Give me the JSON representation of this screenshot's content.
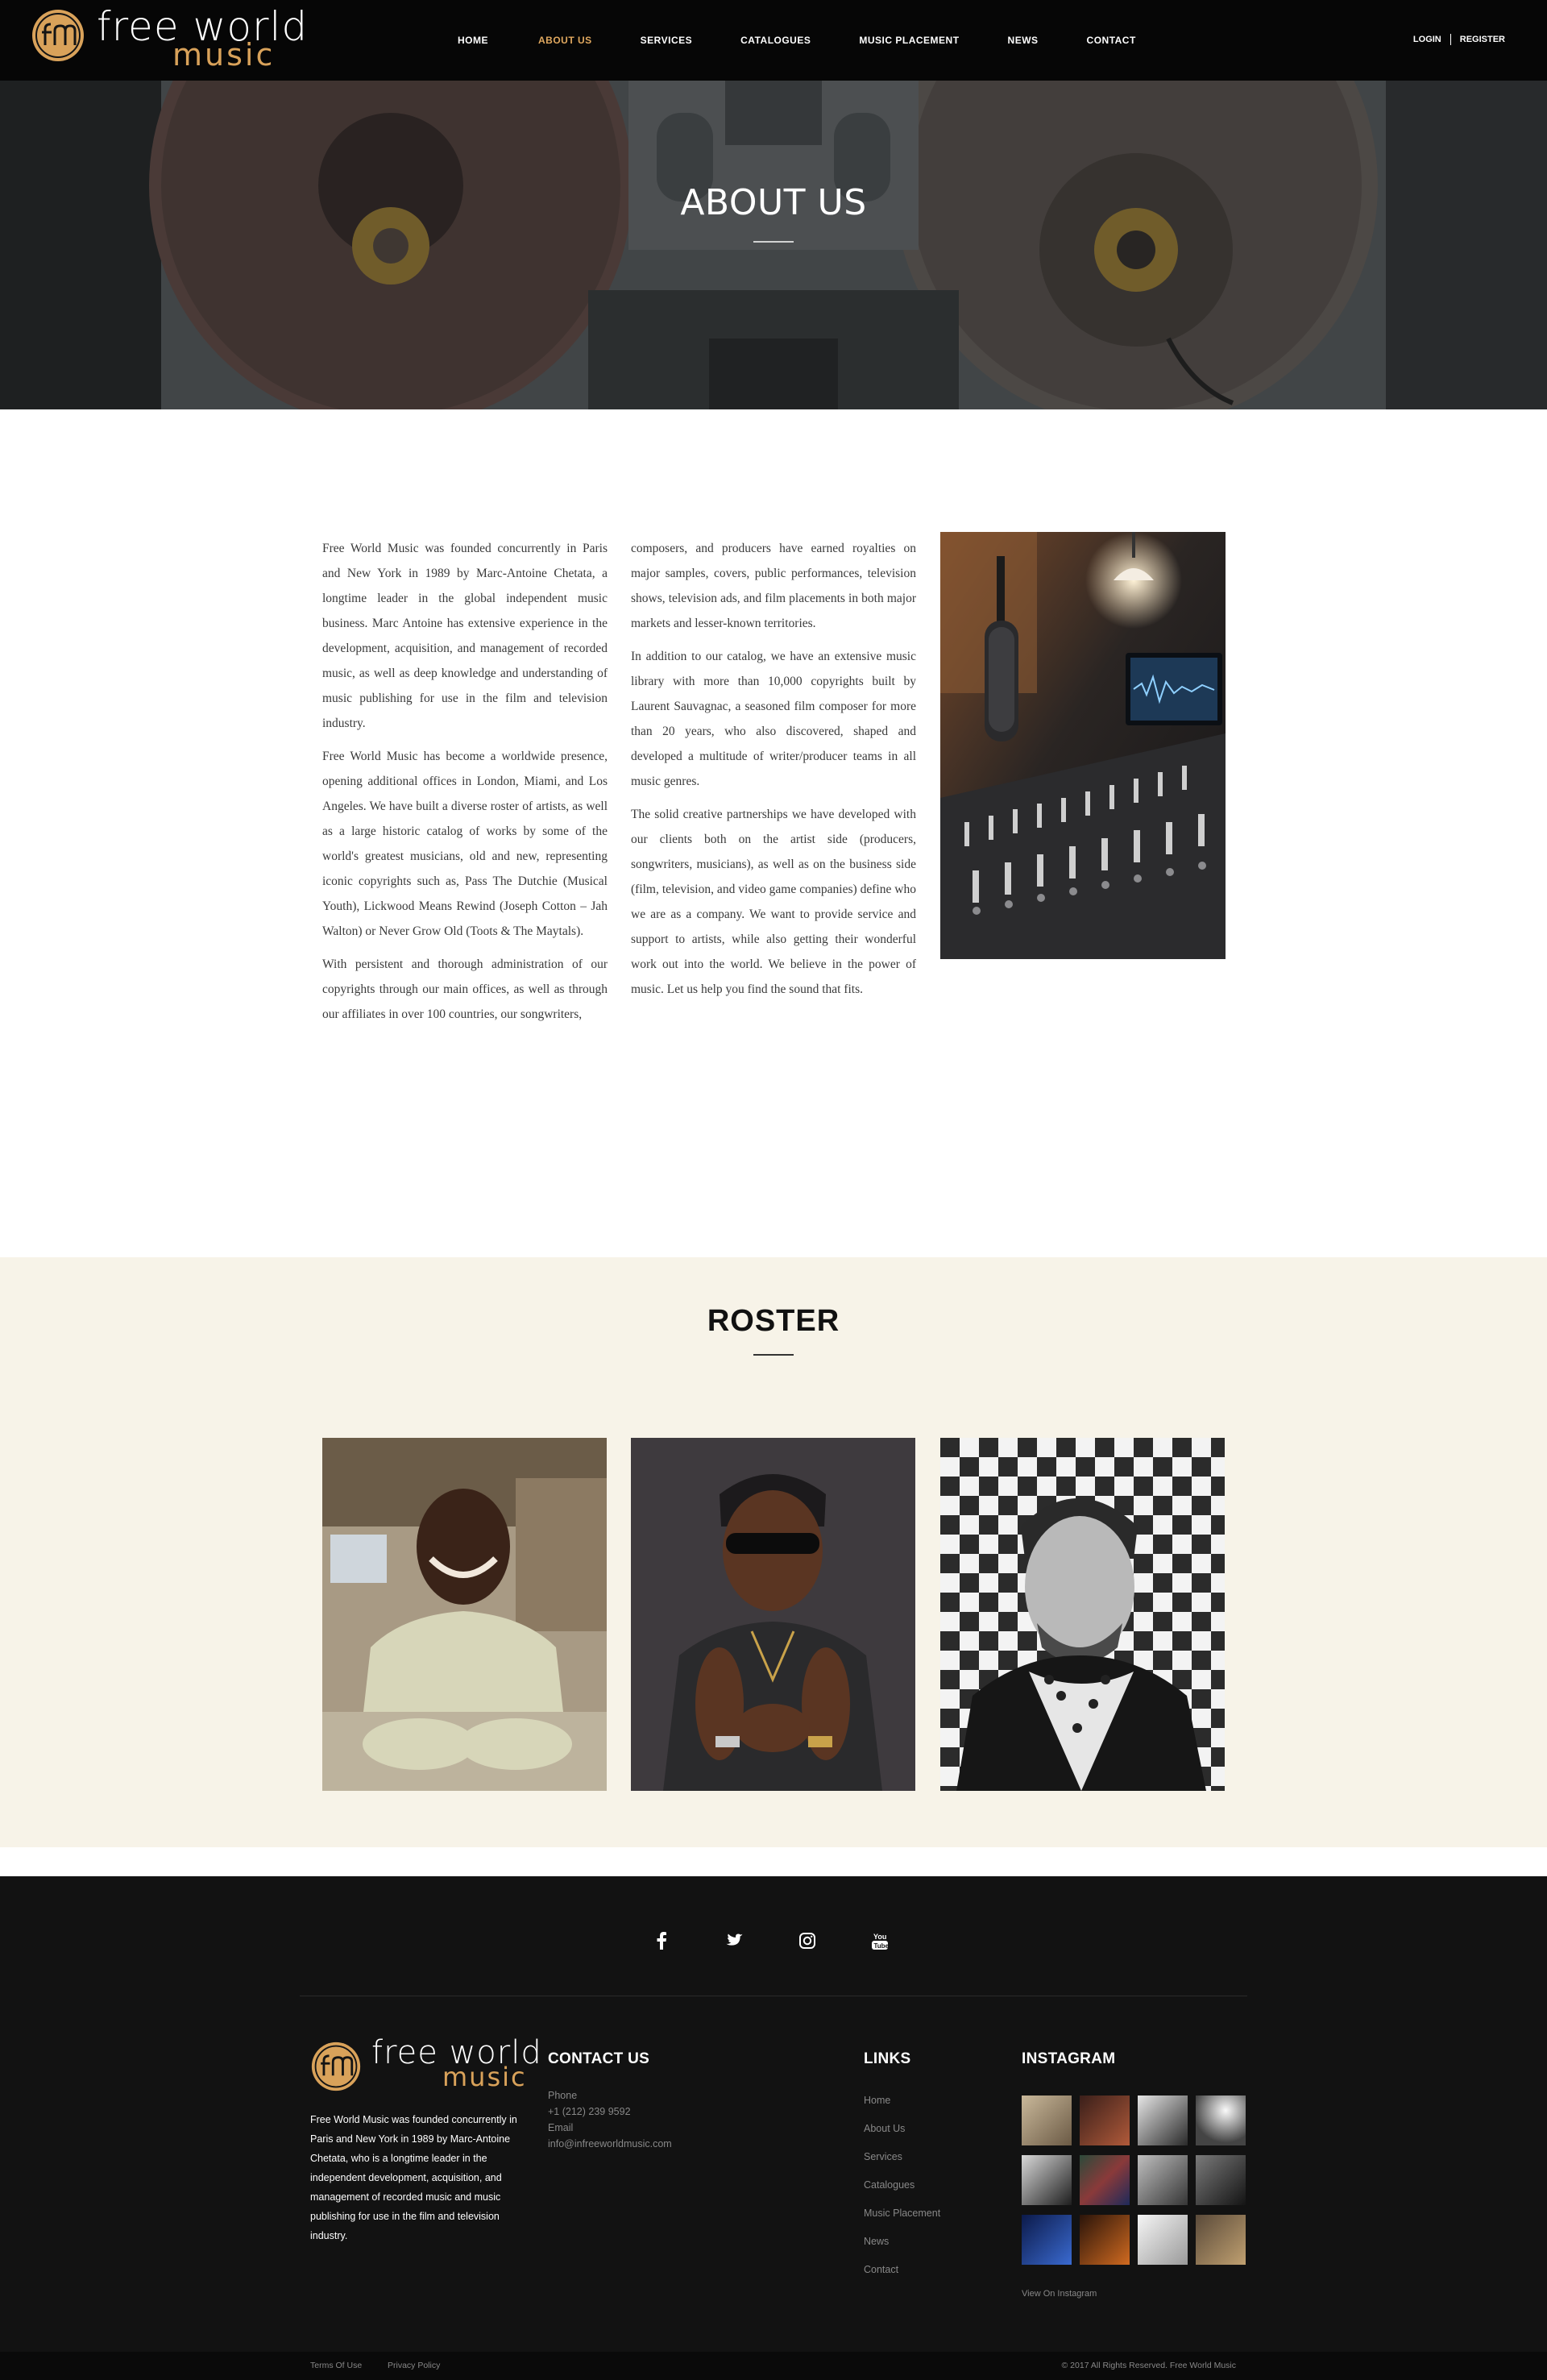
{
  "brand": {
    "word1": "free world",
    "word2": "music",
    "accent": "#d9a25a"
  },
  "nav": {
    "items": [
      {
        "label": "HOME"
      },
      {
        "label": "ABOUT US",
        "active": true
      },
      {
        "label": "SERVICES"
      },
      {
        "label": "CATALOGUES"
      },
      {
        "label": "MUSIC PLACEMENT"
      },
      {
        "label": "NEWS"
      },
      {
        "label": "CONTACT"
      }
    ],
    "login": "LOGIN",
    "register": "REGISTER"
  },
  "hero": {
    "title": "ABOUT US"
  },
  "about": {
    "col1": [
      "Free World Music was founded concurrently in Paris and New York in 1989 by Marc-Antoine Chetata, a longtime leader in the global independent music business. Marc Antoine has extensive experience in the development, acquisition, and management of recorded music, as well as deep knowledge and understanding of music publishing for use in the film and television industry.",
      "Free World Music has become a worldwide presence, opening additional offices in London, Miami, and Los Angeles. We have built a diverse roster of artists, as well as a large historic catalog of works by some of the world's greatest musicians, old and new, representing iconic copyrights such as, Pass The Dutchie (Musical Youth), Lickwood Means Rewind (Joseph Cotton – Jah Walton) or Never Grow Old (Toots & The Maytals).",
      "With persistent and thorough administration of our copyrights through our main offices, as well as through our affiliates in over 100 countries, our songwriters,"
    ],
    "col2": [
      "composers, and producers have earned royalties on major samples, covers, public performances, television shows, television ads, and film placements in both major markets and lesser-known territories.",
      "In addition to our catalog, we have an extensive music library with more than 10,000 copyrights built by Laurent Sauvagnac, a seasoned film composer for more than 20 years, who also discovered, shaped and developed a multitude of writer/producer teams in all music genres.",
      "The solid creative partnerships we have developed with our clients both on the artist side (producers, songwriters, musicians), as well as on the business side (film, television, and video game companies) define who we are as a company. We want to provide service and support to artists, while also getting their wonderful work out into the world. We believe in the power of music. Let us help you find the sound that fits."
    ]
  },
  "roster": {
    "title": "ROSTER"
  },
  "footer": {
    "about_text": "Free World Music was founded concurrently in Paris and New York in 1989 by Marc-Antoine Chetata, who is a longtime leader in the independent development, acquisition, and management of recorded music and music publishing for use in the film and television industry.",
    "contact": {
      "heading": "CONTACT US",
      "phone_label": "Phone",
      "phone": "+1 (212) 239 9592",
      "email_label": "Email",
      "email": "info@infreeworldmusic.com"
    },
    "links": {
      "heading": "LINKS",
      "items": [
        "Home",
        "About Us",
        "Services",
        "Catalogues",
        "Music Placement",
        "News",
        "Contact"
      ]
    },
    "instagram": {
      "heading": "INSTAGRAM",
      "view_label": "View On Instagram"
    },
    "social_icons": [
      "facebook-icon",
      "twitter-icon",
      "instagram-icon",
      "youtube-icon"
    ],
    "terms": "Terms Of Use",
    "privacy": "Privacy Policy",
    "copyright": "© 2017 All Rights Reserved. Free World Music"
  }
}
